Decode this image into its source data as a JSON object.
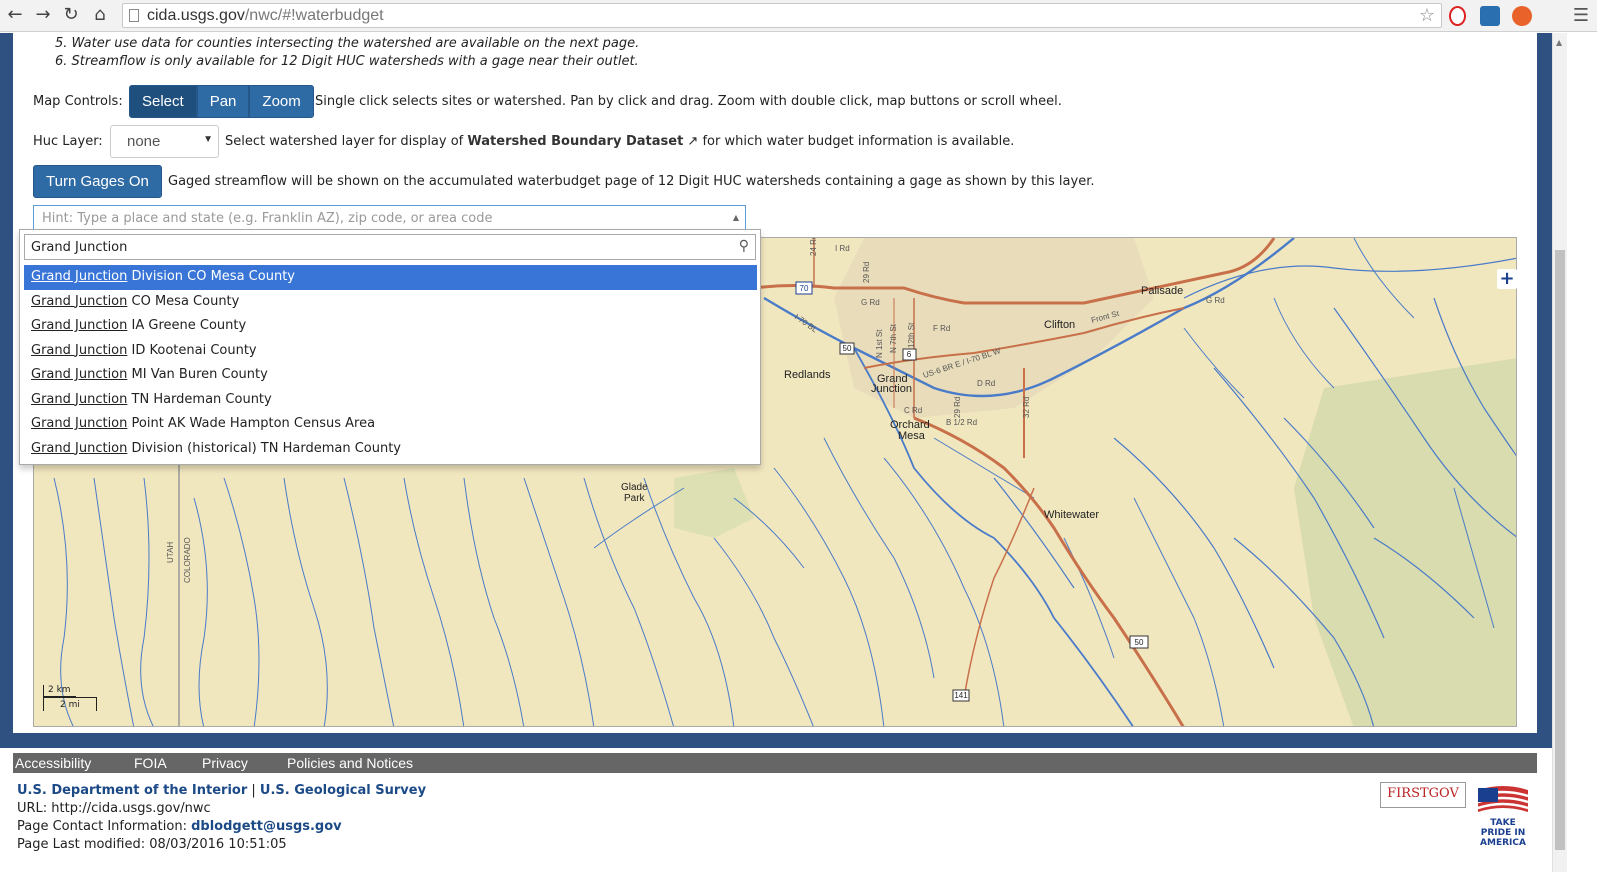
{
  "browser": {
    "url_host": "cida.usgs.gov",
    "url_path": "/nwc/#!waterbudget"
  },
  "notes": [
    "5. Water use data for counties intersecting the watershed are available on the next page.",
    "6. Streamflow is only available for 12 Digit HUC watersheds with a gage near their outlet."
  ],
  "map_controls": {
    "label": "Map Controls:",
    "buttons": [
      "Select",
      "Pan",
      "Zoom"
    ],
    "description": "Single click selects sites or watershed. Pan by click and drag. Zoom with double click, map buttons or scroll wheel."
  },
  "huc_layer": {
    "label": "Huc Layer:",
    "value": "none",
    "desc_before": "Select watershed layer for display of",
    "link": "Watershed Boundary Dataset",
    "desc_after": "for which water budget information is available."
  },
  "gages": {
    "button": "Turn Gages On",
    "description": "Gaged streamflow will be shown on the accumulated waterbudget page of 12 Digit HUC watersheds containing a gage as shown by this layer."
  },
  "place_search": {
    "placeholder": "Hint: Type a place and state (e.g. Franklin AZ), zip code, or area code",
    "query": "Grand Junction",
    "results": [
      {
        "match": "Grand Junction",
        "rest": "Division CO Mesa County"
      },
      {
        "match": "Grand Junction",
        "rest": "CO Mesa County"
      },
      {
        "match": "Grand Junction",
        "rest": "IA Greene County"
      },
      {
        "match": "Grand Junction",
        "rest": "ID Kootenai County"
      },
      {
        "match": "Grand Junction",
        "rest": "MI Van Buren County"
      },
      {
        "match": "Grand Junction",
        "rest": "TN Hardeman County"
      },
      {
        "match": "Grand Junction",
        "rest": "Point AK Wade Hampton Census Area"
      },
      {
        "match": "Grand Junction",
        "rest": "Division (historical) TN Hardeman County"
      }
    ],
    "highlighted_index": 0
  },
  "map": {
    "labels": {
      "palisade": "Palisade",
      "clifton": "Clifton",
      "redlands": "Redlands",
      "grand": "Grand",
      "junction": "Junction",
      "orchard": "Orchard",
      "mesa": "Mesa",
      "glade": "Glade",
      "park": "Park",
      "whitewater": "Whitewater",
      "utah": "UTAH",
      "colorado": "COLORADO",
      "i70": "70",
      "us50": "50",
      "us6": "6",
      "hwy141": "141",
      "us6br": "US-6 BR E / I-70 BL W",
      "i70bl": "I-70 BL",
      "frontst": "Front St",
      "grd": "G Rd",
      "frd": "F Rd",
      "drd": "D Rd",
      "crd": "C Rd",
      "b12rd": "B 1/2 Rd",
      "rd32": "32 Rd",
      "n1st": "N 1st St",
      "n7th": "N 7th St",
      "n12th": "N 12th St",
      "rd24": "24 Rd",
      "rd29": "29 Rd",
      "ird": "I Rd"
    },
    "scale_km": "2 km",
    "scale_mi": "2 mi",
    "zoom_in": "+"
  },
  "footer": {
    "links": [
      "Accessibility",
      "FOIA",
      "Privacy",
      "Policies and Notices"
    ],
    "dept": "U.S. Department of the Interior",
    "sep": "|",
    "agency": "U.S. Geological Survey",
    "url_line": "URL: http://cida.usgs.gov/nwc",
    "contact_label": "Page Contact Information:",
    "contact_email": "dblodgett@usgs.gov",
    "modified": "Page Last modified: 08/03/2016 10:51:05",
    "firstgov": "FIRSTGOV",
    "pride": "TAKE PRIDE IN AMERICA"
  },
  "colors": {
    "page_border": "#2f5181",
    "button_blue": "#2e6aa4",
    "highlight": "#3875d7",
    "map_land": "#f1e7bf",
    "river": "#4a7bc8",
    "road": "#c8704a"
  }
}
